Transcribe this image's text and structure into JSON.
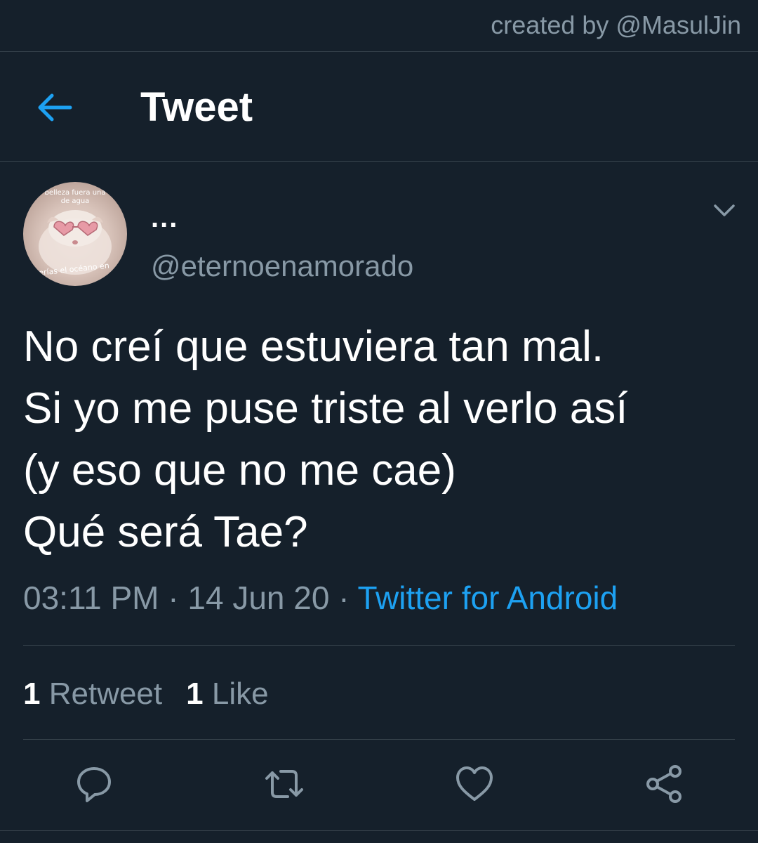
{
  "credit": "created by @MasulJin",
  "header": {
    "title": "Tweet"
  },
  "author": {
    "name": "...",
    "handle": "@eternoenamorado",
    "avatar_text_top_1": "belleza fuera una",
    "avatar_text_top_2": "de agua",
    "avatar_text_bottom": "serías el océano en"
  },
  "tweet": {
    "lines": [
      "No creí que estuviera tan mal.",
      "Si yo me puse triste al verlo así",
      "(y eso que no me cae)",
      "Qué será Tae?"
    ],
    "time": "03:11 PM",
    "sep1": " · ",
    "date": "14 Jun 20",
    "sep2": " · ",
    "source": "Twitter for Android"
  },
  "stats": {
    "retweets_count": "1",
    "retweets_label": "Retweet",
    "likes_count": "1",
    "likes_label": "Like"
  },
  "icons": {
    "back": "arrow-left-icon",
    "caret": "chevron-down-icon",
    "reply": "reply-icon",
    "retweet": "retweet-icon",
    "like": "heart-icon",
    "share": "share-icon"
  },
  "colors": {
    "background": "#15202b",
    "accent": "#1da1f2",
    "secondary_text": "#8899a6",
    "border": "#38444d"
  }
}
